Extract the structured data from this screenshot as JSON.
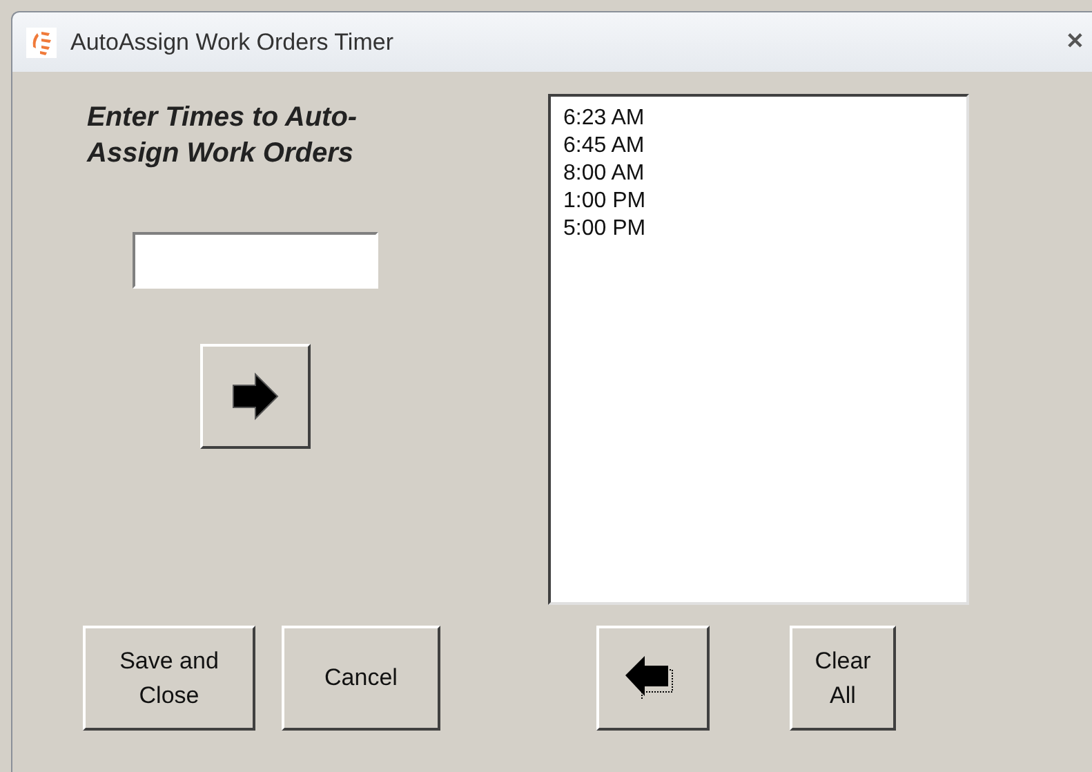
{
  "window": {
    "title": "AutoAssign Work Orders Timer",
    "close": "✕"
  },
  "heading": "Enter Times to Auto-Assign Work Orders",
  "times": [
    {
      "label": "6:23 AM",
      "selected": false
    },
    {
      "label": "6:45 AM",
      "selected": false
    },
    {
      "label": "8:00 AM",
      "selected": false
    },
    {
      "label": "1:00 PM",
      "selected": false
    },
    {
      "label": "5:00 PM",
      "selected": false
    }
  ],
  "buttons": {
    "save": "Save and Close",
    "cancel": "Cancel",
    "clear": "Clear All"
  }
}
